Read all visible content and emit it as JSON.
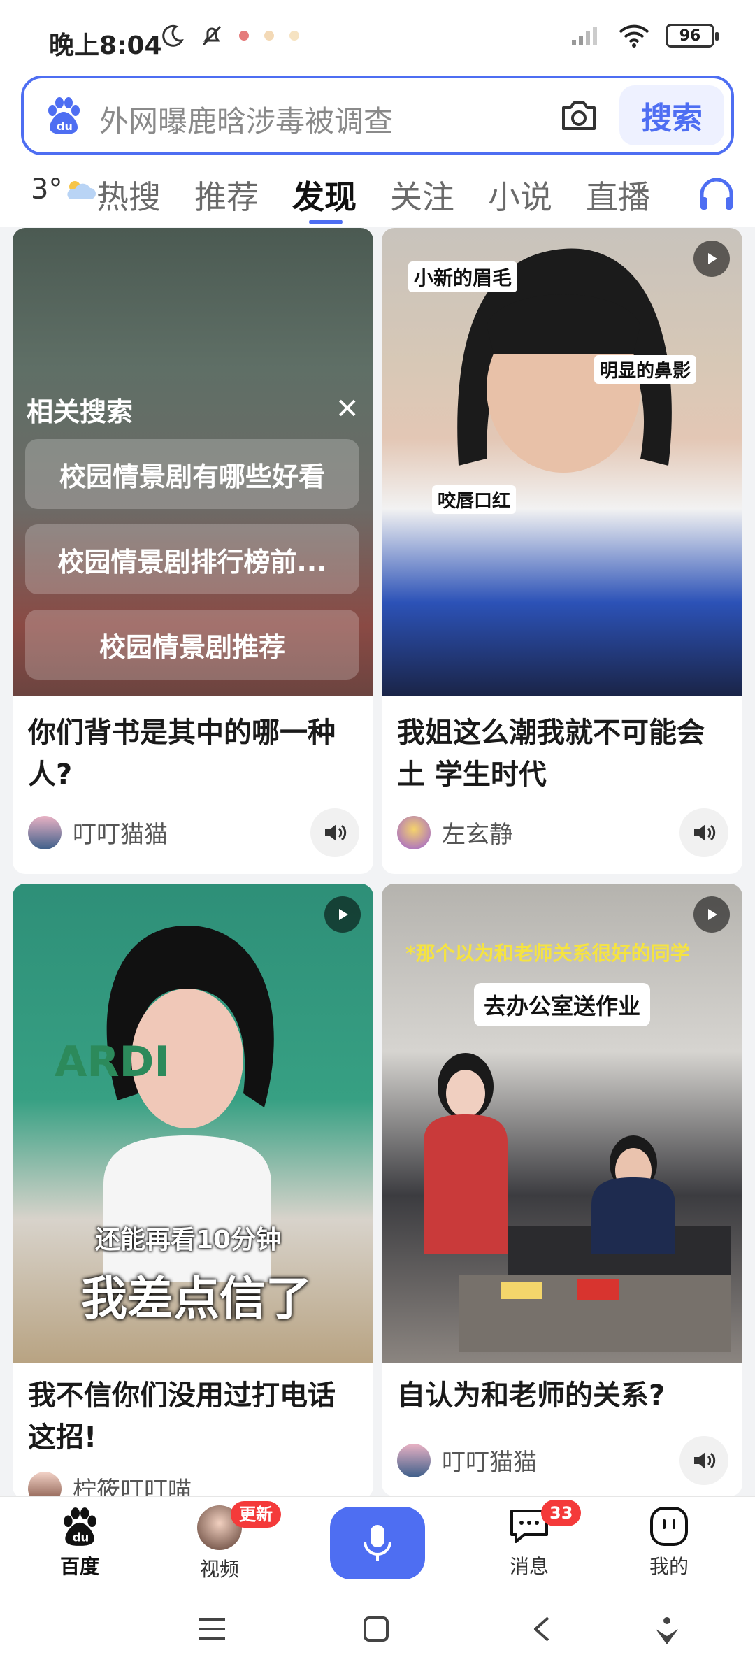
{
  "status_bar": {
    "time": "晚上8:04",
    "battery": "96"
  },
  "search": {
    "query": "外网曝鹿晗涉毒被调查",
    "button_label": "搜索"
  },
  "weather": {
    "temp": "3°"
  },
  "tabs": [
    {
      "label": "热搜"
    },
    {
      "label": "推荐"
    },
    {
      "label": "发现"
    },
    {
      "label": "关注"
    },
    {
      "label": "小说"
    },
    {
      "label": "直播"
    }
  ],
  "active_tab": "发现",
  "related_search": {
    "title": "相关搜索",
    "items": [
      "校园情景剧有哪些好看",
      "校园情景剧排行榜前...",
      "校园情景剧推荐"
    ]
  },
  "cards": [
    {
      "title": "你们背书是其中的哪一种人?",
      "author": "叮叮猫猫"
    },
    {
      "title": "我姐这么潮我就不可能会土 学生时代",
      "author": "左玄静",
      "captions": [
        "小新的眉毛",
        "明显的鼻影",
        "咬唇口红"
      ]
    },
    {
      "title": "我不信你们没用过打电话这招!",
      "author": "柠筱叮叮喵",
      "captions": [
        "还能再看10分钟",
        "我差点信了",
        "ARDI"
      ]
    },
    {
      "title": "自认为和老师的关系?",
      "author": "叮叮猫猫",
      "captions": [
        "*那个以为和老师关系很好的同学",
        "去办公室送作业"
      ]
    }
  ],
  "bottom_nav": {
    "home": "百度",
    "video": "视频",
    "video_badge": "更新",
    "messages": "消息",
    "messages_badge": "33",
    "me": "我的"
  },
  "colors": {
    "accent": "#4e6ef2",
    "badge": "#f43a3a"
  },
  "icons": [
    "moon-icon",
    "mute-bell-icon",
    "signal-icon",
    "wifi-icon",
    "battery-icon",
    "camera-icon",
    "headset-icon",
    "speaker-icon",
    "play-icon",
    "mic-icon",
    "message-icon",
    "robot-icon"
  ]
}
